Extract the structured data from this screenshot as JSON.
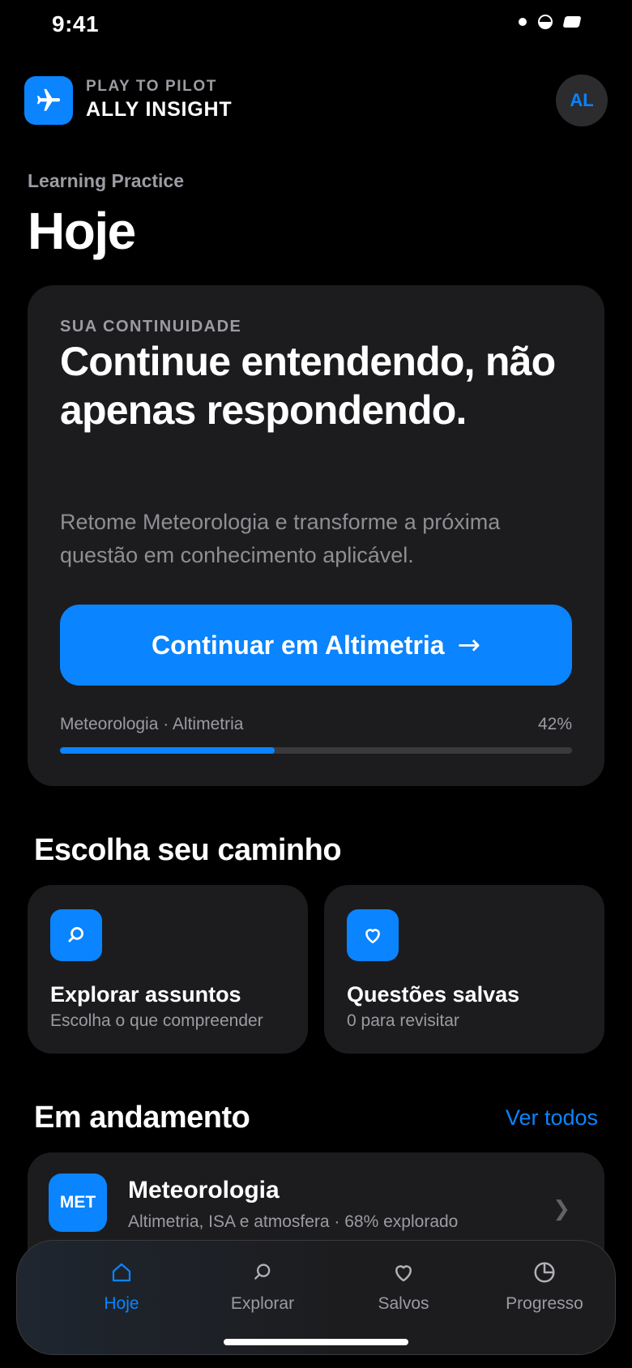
{
  "status_bar": {
    "time": "9:41"
  },
  "header": {
    "brand_subtitle": "PLAY TO PILOT",
    "brand_title": "ALLY INSIGHT",
    "avatar_initials": "AL"
  },
  "page": {
    "kicker": "Learning Practice",
    "title": "Hoje"
  },
  "hero": {
    "kicker": "SUA CONTINUIDADE",
    "title": "Continue entendendo, não apenas respondendo.",
    "description": "Retome Meteorologia e transforme a próxima questão em conhecimento aplicável.",
    "cta_label": "Continuar em Altimetria",
    "cta_arrow": "→",
    "progress_label": "Meteorologia · Altimetria",
    "progress_text": "42%",
    "progress_value": 42
  },
  "paths": {
    "title": "Escolha seu caminho",
    "items": [
      {
        "title": "Explorar assuntos",
        "subtitle": "Escolha o que compreender"
      },
      {
        "title": "Questões salvas",
        "subtitle": "0 para revisitar"
      }
    ]
  },
  "in_progress": {
    "title": "Em andamento",
    "see_all": "Ver todos",
    "items": [
      {
        "badge": "MET",
        "title": "Meteorologia",
        "subtitle": "Altimetria, ISA e atmosfera · 68% explorado"
      }
    ]
  },
  "tabbar": {
    "items": [
      {
        "label": "Hoje"
      },
      {
        "label": "Explorar"
      },
      {
        "label": "Salvos"
      },
      {
        "label": "Progresso"
      }
    ]
  },
  "colors": {
    "accent": "#0a84ff",
    "card": "#1c1c1e",
    "muted": "#9b9ba2"
  },
  "icons": [
    "airplane-icon",
    "search-icon",
    "heart-icon",
    "home-icon",
    "pie-chart-icon",
    "chevron-right-icon"
  ]
}
